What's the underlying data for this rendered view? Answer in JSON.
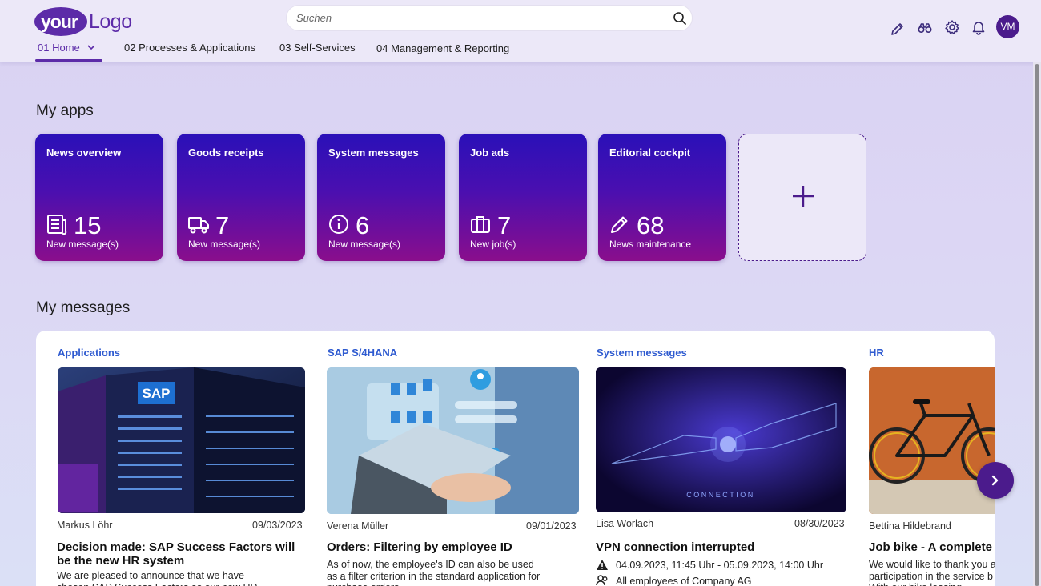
{
  "logo": {
    "part1": "your",
    "part2": "Logo"
  },
  "search": {
    "placeholder": "Suchen",
    "value": ""
  },
  "nav": {
    "tabs": [
      {
        "label": "01 Home"
      },
      {
        "label": "02 Processes & Applications"
      },
      {
        "label": "03 Self-Services"
      },
      {
        "label": "04 Management & Reporting"
      }
    ]
  },
  "user": {
    "initials": "VM"
  },
  "apps": {
    "title": "My apps",
    "tiles": [
      {
        "title": "News overview",
        "count": "15",
        "sub": "New message(s)",
        "icon": "newspaper-icon"
      },
      {
        "title": "Goods receipts",
        "count": "7",
        "sub": "New message(s)",
        "icon": "truck-icon"
      },
      {
        "title": "System messages",
        "count": "6",
        "sub": "New message(s)",
        "icon": "info-icon"
      },
      {
        "title": "Job ads",
        "count": "7",
        "sub": "New job(s)",
        "icon": "briefcase-icon"
      },
      {
        "title": "Editorial cockpit",
        "count": "68",
        "sub": "News maintenance",
        "icon": "pencil-icon"
      }
    ]
  },
  "messages": {
    "title": "My messages",
    "items": [
      {
        "category": "Applications",
        "author": "Markus Löhr",
        "date": "09/03/2023",
        "headline": "Decision made: SAP Success Factors will be the new HR system",
        "body": "We are pleased to announce that we have chosen SAP Success Factors as our new HR"
      },
      {
        "category": "SAP S/4HANA",
        "author": "Verena Müller",
        "date": "09/01/2023",
        "headline": "Orders: Filtering by employee ID",
        "body": "As of now, the employee's ID can also be used as a filter criterion in the standard application for purchase orders."
      },
      {
        "category": "System messages",
        "author": "Lisa Worlach",
        "date": "08/30/2023",
        "headline": "VPN connection interrupted",
        "line1": "04.09.2023, 11:45 Uhr - 05.09.2023, 14:00 Uhr",
        "line2": "All employees of Company AG",
        "image_text": "CONNECTION"
      },
      {
        "category": "HR",
        "author": "Bettina Hildebrand",
        "date": "",
        "headline": "Job bike - A complete s",
        "body": "We would like to thank you a participation in the service b With our bike leasing"
      }
    ]
  },
  "colors": {
    "accent": "#5c2ba8",
    "link": "#2f5bd0",
    "tile_top": "#2a10b8",
    "tile_bottom": "#8a0e8c"
  }
}
